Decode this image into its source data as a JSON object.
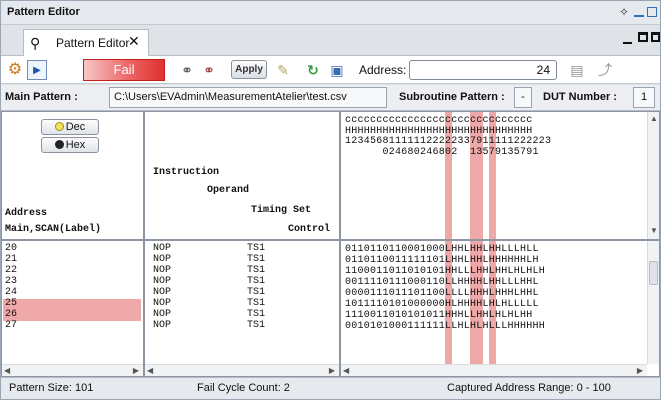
{
  "window": {
    "title": "Pattern Editor",
    "pin_icon": "pin-icon",
    "minimize_icon": "minimize-icon",
    "maximize_icon": "maximize-icon"
  },
  "tab": {
    "icon": "pattern-editor-icon",
    "label": "Pattern Editor",
    "close": "✕"
  },
  "toolbar": {
    "status_label": "Fail",
    "status_color": "#de3131",
    "apply_label": "Apply",
    "address_label": "Address:",
    "address_value": "24"
  },
  "patternbar": {
    "main_pattern_label": "Main Pattern :",
    "main_pattern_path": "C:\\Users\\EVAdmin\\MeasurementAtelier\\test.csv",
    "subroutine_label": "Subroutine Pattern :",
    "subroutine_value": "-",
    "dut_label": "DUT Number :",
    "dut_value": "1"
  },
  "radix": {
    "dec_label": "Dec",
    "hex_label": "Hex"
  },
  "headers": {
    "address_1": "Address",
    "address_2": "Main,SCAN(Label)",
    "instruction": "Instruction",
    "operand": "Operand",
    "timing_set": "Timing Set",
    "control": "Control"
  },
  "bit_header_lines": [
    "cccccccccccccccccccccccccccccc",
    "HHHHHHHHHHHHHHHHHHHHHHHHHHHHHH",
    "123456811111122222337911111222223",
    "      024680246802  13579135791"
  ],
  "highlight_bit_columns": [
    16,
    20,
    21,
    23
  ],
  "rows": [
    {
      "address": "20",
      "instruction": "NOP",
      "timing_set": "TS1",
      "bits": "0110110110001000LHHLHHLHHLLLHLL",
      "highlight": false
    },
    {
      "address": "21",
      "instruction": "NOP",
      "timing_set": "TS1",
      "bits": "0110110011111101LHHLHHLHHHHHHLH",
      "highlight": false
    },
    {
      "address": "22",
      "instruction": "NOP",
      "timing_set": "TS1",
      "bits": "1100011011010101HHLLLHHLHHLHLHLH",
      "highlight": false
    },
    {
      "address": "23",
      "instruction": "NOP",
      "timing_set": "TS1",
      "bits": "0011110111000110LLHHHHLHHLLLHHL",
      "highlight": false
    },
    {
      "address": "24",
      "instruction": "NOP",
      "timing_set": "TS1",
      "bits": "0000111011101100LLLLHHHLHHHLHHL",
      "highlight": false
    },
    {
      "address": "25",
      "instruction": "NOP",
      "timing_set": "TS1",
      "bits": "1011110101000000HLHHHHLHLHLLLLL",
      "highlight": true
    },
    {
      "address": "26",
      "instruction": "NOP",
      "timing_set": "TS1",
      "bits": "1110011010101011HHHLLHHLHLHLHH",
      "highlight": true
    },
    {
      "address": "27",
      "instruction": "NOP",
      "timing_set": "TS1",
      "bits": "0010101000111111LLHLHLHLLLHHHHHH",
      "highlight": false
    }
  ],
  "status": {
    "pattern_size": "Pattern Size:  101",
    "fail_cycle": "Fail Cycle Count:  2",
    "captured_range": "Captured Address Range:  0 - 100"
  },
  "colors": {
    "highlight": "#efa8a8",
    "fail_red": "#de3131",
    "accent_blue": "#2d6fc0"
  }
}
